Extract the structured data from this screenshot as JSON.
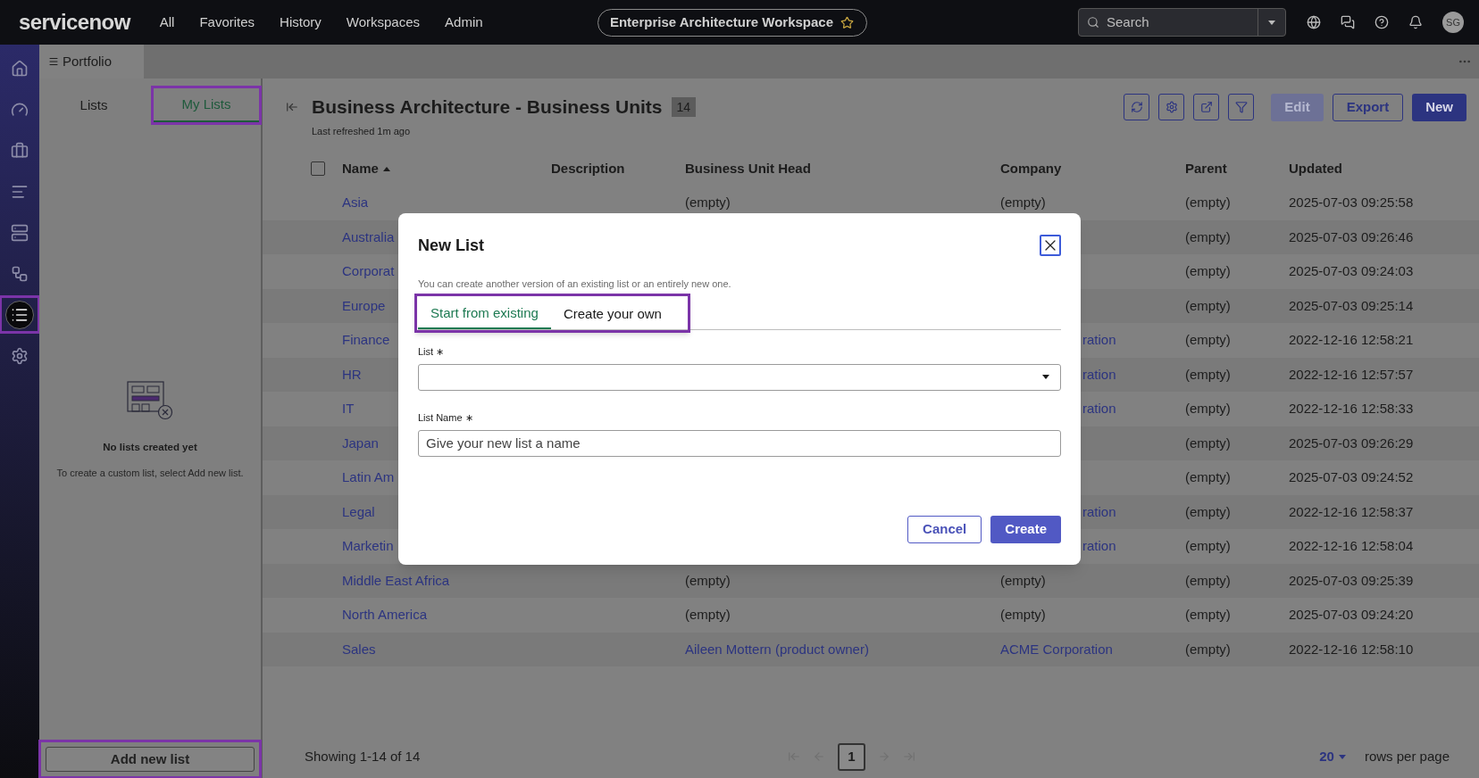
{
  "top_bar": {
    "logo": "servicenow",
    "nav": [
      "All",
      "Favorites",
      "History",
      "Workspaces",
      "Admin"
    ],
    "workspace": "Enterprise Architecture Workspace",
    "search": {
      "placeholder": "Search"
    },
    "avatar": "SG"
  },
  "rail": [
    {
      "kind": "home",
      "selected": false,
      "highlighted": false
    },
    {
      "kind": "gauge",
      "selected": false,
      "highlighted": false
    },
    {
      "kind": "briefcase",
      "selected": false,
      "highlighted": false
    },
    {
      "kind": "bars",
      "selected": false,
      "highlighted": false
    },
    {
      "kind": "server",
      "selected": false,
      "highlighted": false
    },
    {
      "kind": "workflow",
      "selected": false,
      "highlighted": false
    },
    {
      "kind": "list",
      "selected": true,
      "highlighted": true
    },
    {
      "kind": "settings",
      "selected": false,
      "highlighted": false
    }
  ],
  "tab_strip": {
    "tab": "Portfolio"
  },
  "side_panel": {
    "tabs": [
      {
        "label": "Lists",
        "selected": false,
        "highlighted": false
      },
      {
        "label": "My Lists",
        "selected": true,
        "highlighted": true
      }
    ],
    "empty_title": "No lists created yet",
    "empty_text": "To create a custom list, select Add new list.",
    "add_button": {
      "label": "Add new list",
      "highlighted": true
    }
  },
  "list": {
    "title": "Business Architecture - Business Units",
    "count": "14",
    "refreshed": "Last refreshed 1m ago",
    "icon_actions": [
      {
        "kind": "refresh"
      },
      {
        "kind": "settings"
      },
      {
        "kind": "open"
      },
      {
        "kind": "filter"
      }
    ],
    "select_all": {
      "checked": false
    },
    "buttons": [
      {
        "label": "Edit",
        "disabled": true,
        "primary": false
      },
      {
        "label": "Export",
        "disabled": false,
        "primary": false
      },
      {
        "label": "New",
        "disabled": false,
        "primary": true
      }
    ],
    "columns": [
      {
        "label": "Name",
        "sorted": true
      },
      {
        "label": "Description"
      },
      {
        "label": "Business Unit Head"
      },
      {
        "label": "Company"
      },
      {
        "label": "Parent"
      },
      {
        "label": "Updated"
      }
    ],
    "rows": [
      {
        "name": "Asia",
        "head": "(empty)",
        "head_link": false,
        "company": "(empty)",
        "company_link": false,
        "parent": "(empty)",
        "updated": "2025-07-03 09:25:58"
      },
      {
        "name": "Australia",
        "parent": "(empty)",
        "updated": "2025-07-03 09:26:46"
      },
      {
        "name": "Corporat",
        "parent": "(empty)",
        "updated": "2025-07-03 09:24:03"
      },
      {
        "name": "Europe",
        "parent": "(empty)",
        "updated": "2025-07-03 09:25:14"
      },
      {
        "name": "Finance",
        "company": "ration",
        "company_link": true,
        "parent": "(empty)",
        "updated": "2022-12-16 12:58:21"
      },
      {
        "name": "HR",
        "company": "ration",
        "company_link": true,
        "parent": "(empty)",
        "updated": "2022-12-16 12:57:57"
      },
      {
        "name": "IT",
        "company": "ration",
        "company_link": true,
        "parent": "(empty)",
        "updated": "2022-12-16 12:58:33"
      },
      {
        "name": "Japan",
        "parent": "(empty)",
        "updated": "2025-07-03 09:26:29"
      },
      {
        "name": "Latin Am",
        "parent": "(empty)",
        "updated": "2025-07-03 09:24:52"
      },
      {
        "name": "Legal",
        "company": "ration",
        "company_link": true,
        "parent": "(empty)",
        "updated": "2022-12-16 12:58:37"
      },
      {
        "name": "Marketin",
        "company": "ration",
        "company_link": true,
        "parent": "(empty)",
        "updated": "2022-12-16 12:58:04"
      },
      {
        "name": "Middle East Africa",
        "head": "(empty)",
        "head_link": false,
        "company": "(empty)",
        "company_link": false,
        "parent": "(empty)",
        "updated": "2025-07-03 09:25:39"
      },
      {
        "name": "North America",
        "head": "(empty)",
        "head_link": false,
        "company": "(empty)",
        "company_link": false,
        "parent": "(empty)",
        "updated": "2025-07-03 09:24:20"
      },
      {
        "name": "Sales",
        "head": "Aileen Mottern (product owner)",
        "head_link": true,
        "company": "ACME Corporation",
        "company_link": true,
        "parent": "(empty)",
        "updated": "2022-12-16 12:58:10"
      }
    ],
    "footer": {
      "showing": "Showing 1-14 of 14",
      "pages": [
        {
          "label": "1",
          "selected": true
        }
      ],
      "rows_per_page": "20",
      "rows_per_page_label": "rows per page"
    }
  },
  "dialog": {
    "title": "New List",
    "description": "You can create another version of an existing list or an entirely new one.",
    "tabs_highlighted": true,
    "tabs": [
      {
        "label": "Start from existing",
        "selected": true
      },
      {
        "label": "Create your own",
        "selected": false
      }
    ],
    "fields": [
      {
        "kind": "select",
        "label": "List ∗"
      },
      {
        "kind": "text",
        "label": "List Name ∗",
        "placeholder": "Give your new list a name"
      }
    ],
    "buttons": [
      {
        "label": "Cancel",
        "primary": false
      },
      {
        "label": "Create",
        "primary": true
      }
    ]
  }
}
